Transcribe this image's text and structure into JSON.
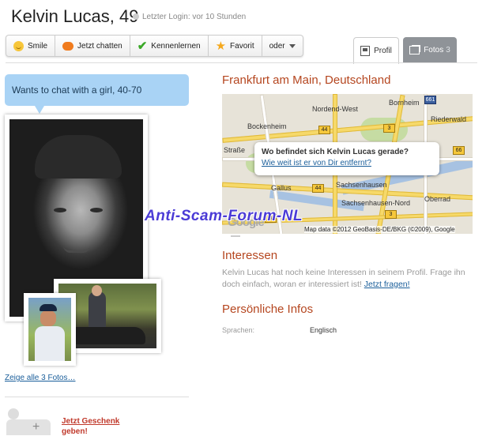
{
  "header": {
    "name": "Kelvin Lucas, 49",
    "login_status": "Letzter Login: vor 10 Stunden"
  },
  "actions": [
    {
      "label": "Smile",
      "icon": "smile-icon"
    },
    {
      "label": "Jetzt chatten",
      "icon": "chat-bubble-icon"
    },
    {
      "label": "Kennenlernen",
      "icon": "checkmark-icon"
    },
    {
      "label": "Favorit",
      "icon": "star-icon"
    },
    {
      "label": "oder",
      "icon": "chevron-down-icon"
    }
  ],
  "tabs": {
    "profil": "Profil",
    "fotos": "Fotos",
    "fotos_count": "3"
  },
  "left": {
    "speech": "Wants to chat with a girl, 40-70",
    "show_all_photos": "Zeige alle 3 Fotos…",
    "gift_link": "Jetzt Geschenk",
    "gift_link2": "geben!"
  },
  "location": {
    "city": "Frankfurt am Main, Deutschland",
    "map_question": "Wo befindet sich Kelvin Lucas gerade?",
    "map_link": "Wie weit ist er von Dir entfernt?",
    "map_brand": "Google",
    "map_credit": "Map data ©2012 GeoBasis-DE/BKG (©2009), Google",
    "map_labels": [
      "Nordend-West",
      "Bornheim",
      "Riederwald",
      "Bockenheim",
      "Straße",
      "Gallus",
      "Sachsenhausen",
      "Sachsenhausen-Nord",
      "Oberrad"
    ],
    "map_shields": [
      "661",
      "66",
      "3",
      "3",
      "44",
      "44",
      "3"
    ]
  },
  "watermark": "Anti-Scam-Forum-NL",
  "interessen": {
    "title": "Interessen",
    "text": "Kelvin Lucas hat noch keine Interessen in seinem Profil. Frage ihn doch einfach, woran er interessiert ist!",
    "link": "Jetzt fragen!"
  },
  "infos": {
    "title": "Persönliche Infos",
    "language_label": "Sprachen:",
    "language_value": "Englisch"
  },
  "colors": {
    "accent": "#b5461f",
    "link": "#1a5e9a",
    "speech_bubble": "#a9d3f5",
    "fotos_tab": "#8f9398"
  }
}
